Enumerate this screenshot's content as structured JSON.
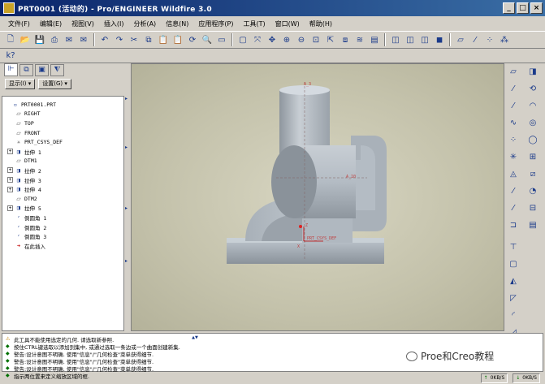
{
  "window": {
    "title": "PRT0001 (活动的) - Pro/ENGINEER Wildfire 3.0"
  },
  "menu": [
    {
      "label": "文件(F)"
    },
    {
      "label": "编辑(E)"
    },
    {
      "label": "视图(V)"
    },
    {
      "label": "插入(I)"
    },
    {
      "label": "分析(A)"
    },
    {
      "label": "信息(N)"
    },
    {
      "label": "应用程序(P)"
    },
    {
      "label": "工具(T)"
    },
    {
      "label": "窗口(W)"
    },
    {
      "label": "帮助(H)"
    }
  ],
  "left_panel": {
    "show_label": "显示(I) ▾",
    "settings_label": "设置(G) ▾"
  },
  "model_tree": [
    {
      "label": "PRT0001.PRT",
      "expandable": false,
      "icon": "part-icon"
    },
    {
      "label": "RIGHT",
      "expandable": false,
      "icon": "datum-plane-icon"
    },
    {
      "label": "TOP",
      "expandable": false,
      "icon": "datum-plane-icon"
    },
    {
      "label": "FRONT",
      "expandable": false,
      "icon": "datum-plane-icon"
    },
    {
      "label": "PRT_CSYS_DEF",
      "expandable": false,
      "icon": "csys-icon"
    },
    {
      "label": "拉伸 1",
      "expandable": true,
      "icon": "extrude-icon"
    },
    {
      "label": "DTM1",
      "expandable": false,
      "icon": "datum-plane-icon"
    },
    {
      "label": "拉伸 2",
      "expandable": true,
      "icon": "extrude-icon"
    },
    {
      "label": "拉伸 3",
      "expandable": true,
      "icon": "extrude-icon"
    },
    {
      "label": "拉伸 4",
      "expandable": true,
      "icon": "extrude-icon"
    },
    {
      "label": "DTM2",
      "expandable": false,
      "icon": "datum-plane-icon"
    },
    {
      "label": "拉伸 5",
      "expandable": true,
      "icon": "extrude-icon"
    },
    {
      "label": "倒圆角 1",
      "expandable": false,
      "icon": "round-icon"
    },
    {
      "label": "倒圆角 2",
      "expandable": false,
      "icon": "round-icon"
    },
    {
      "label": "倒圆角 3",
      "expandable": false,
      "icon": "round-icon"
    },
    {
      "label": "在此插入",
      "expandable": false,
      "icon": "insert-here-icon"
    }
  ],
  "viewport": {
    "label_axis_top": "A_3",
    "label_axis_mid": "A_10",
    "label_csys": "PRT_CSYS_DEF",
    "label_z": "Z",
    "label_x": "X"
  },
  "messages": [
    {
      "type": "warn",
      "text": "此工具不能使用选定的几何. 请选取新参照."
    },
    {
      "type": "info",
      "text": "按住CTRL键选取以添加到集中, 或通过选取一条边或一个曲面创建新集."
    },
    {
      "type": "info",
      "text": "警告:设计意图不明确. 使用\"信息\"/\"几何检查\"菜单获得细节."
    },
    {
      "type": "info",
      "text": "警告:设计意图不明确. 使用\"信息\"/\"几何检查\"菜单获得细节."
    },
    {
      "type": "info",
      "text": "警告:设计意图不明确. 使用\"信息\"/\"几何检查\"菜单获得细节."
    },
    {
      "type": "info",
      "text": "指示两位置来定义缩放区域的框."
    }
  ],
  "watermark": {
    "text": "Proe和Creo教程"
  },
  "status": {
    "cell1": "0KB/S",
    "cell2": "0KB/S"
  },
  "colors": {
    "title_start": "#0a246a",
    "title_end": "#3a6ea5",
    "model_body": "#b0b8c0",
    "viewport_bg": "#c4c2ab"
  }
}
